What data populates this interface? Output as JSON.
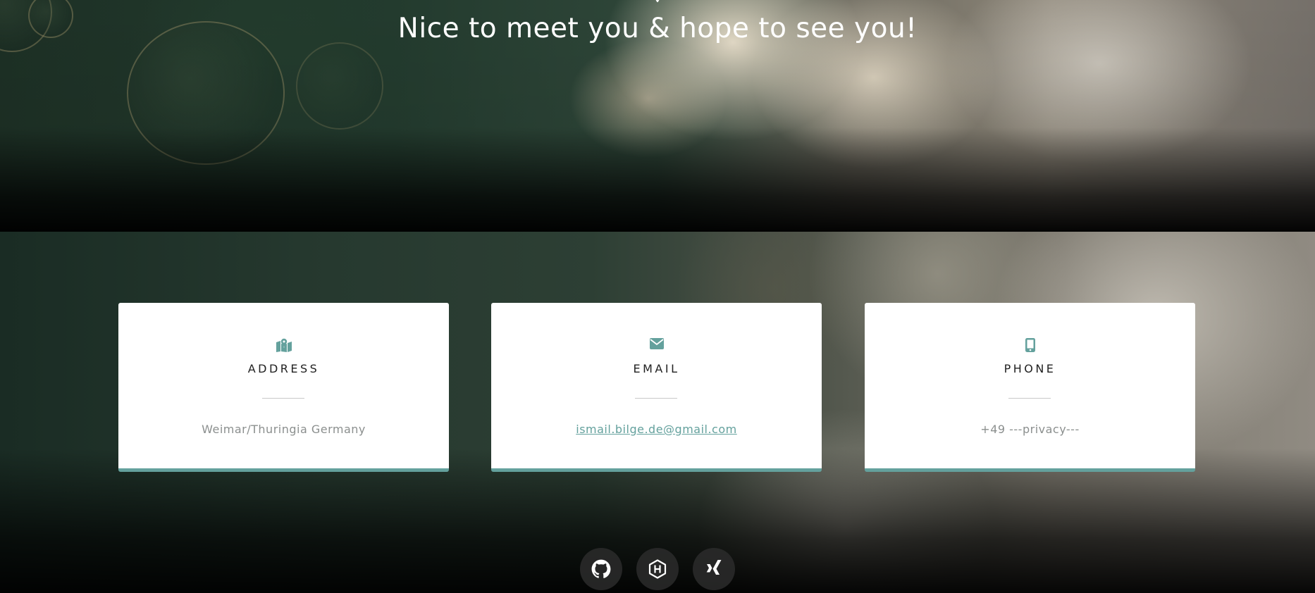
{
  "hero": {
    "title": "Nice to meet you & hope to see you!",
    "icon": "star-icon"
  },
  "contact": {
    "accent_color": "#64a19d",
    "cards": [
      {
        "icon": "map-marked-icon",
        "title": "Address",
        "value": "Weimar/Thuringia Germany"
      },
      {
        "icon": "envelope-icon",
        "title": "Email",
        "value": "ismail.bilge.de@gmail.com",
        "is_link": true
      },
      {
        "icon": "mobile-phone-icon",
        "title": "Phone",
        "value": "+49 ---privacy---"
      }
    ]
  },
  "social": [
    {
      "icon": "github-icon"
    },
    {
      "icon": "hackerrank-icon"
    },
    {
      "icon": "xing-icon"
    }
  ]
}
